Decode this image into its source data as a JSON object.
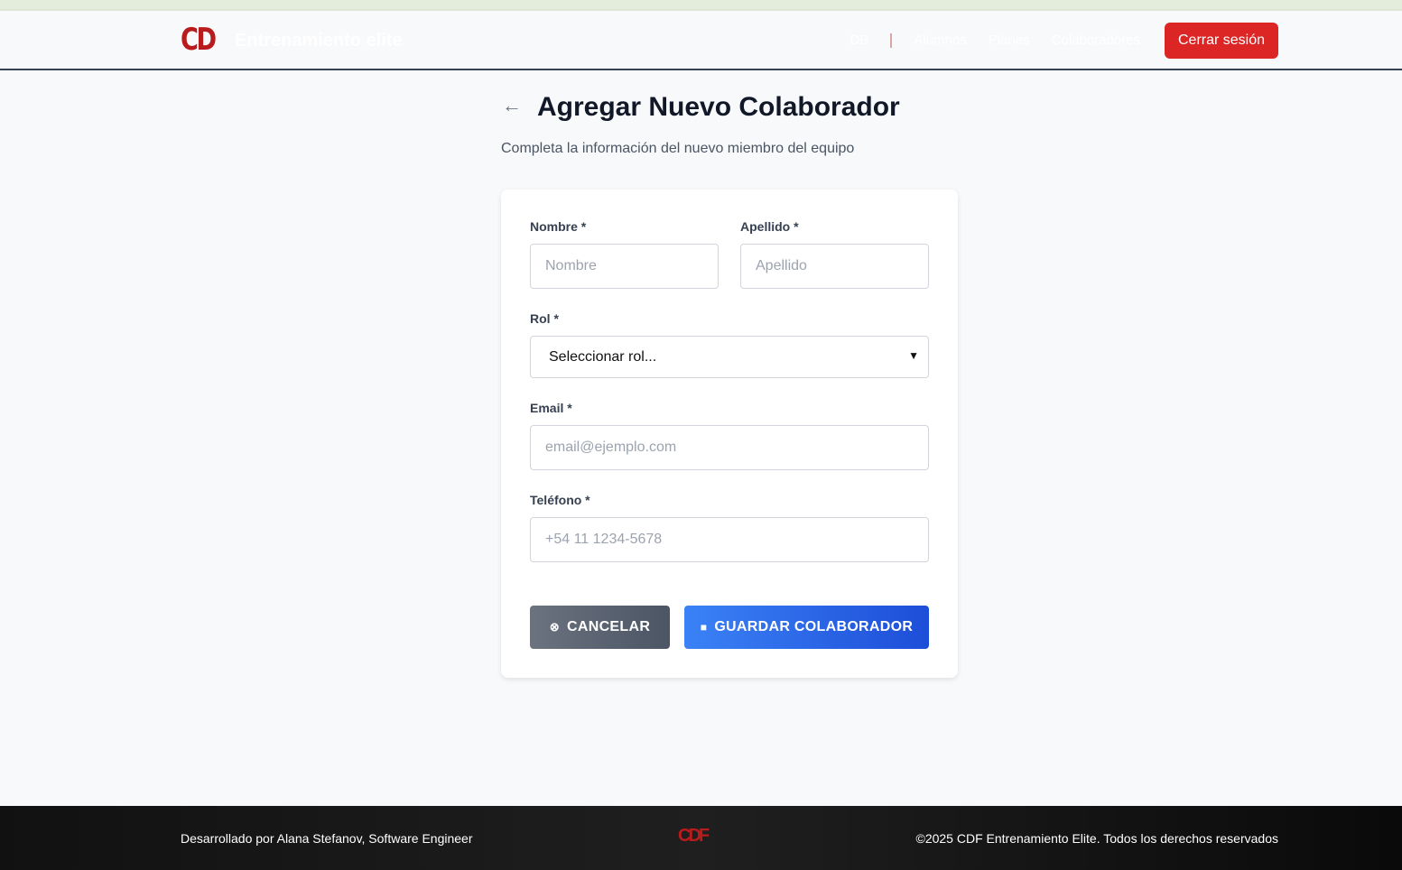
{
  "header": {
    "logo": "CD",
    "brand": "Entrenamiento elite",
    "nav": [
      "DB",
      "Alumnos",
      "Planes",
      "Colaboradores"
    ],
    "logout": "Cerrar sesión"
  },
  "page": {
    "title": "Agregar Nuevo Colaborador",
    "subtitle": "Completa la información del nuevo miembro del equipo"
  },
  "form": {
    "nombre": {
      "label": "Nombre *",
      "placeholder": "Nombre"
    },
    "apellido": {
      "label": "Apellido *",
      "placeholder": "Apellido"
    },
    "rol": {
      "label": "Rol *",
      "value": "Seleccionar rol..."
    },
    "email": {
      "label": "Email *",
      "placeholder": "email@ejemplo.com"
    },
    "telefono": {
      "label": "Teléfono *",
      "placeholder": "+54 11 1234-5678"
    },
    "cancel": "CANCELAR",
    "save": "GUARDAR COLABORADOR"
  },
  "footer": {
    "left": "Desarrollado por Alana Stefanov, Software Engineer",
    "logo": "CDF",
    "right": "©2025 CDF Entrenamiento Elite. Todos los derechos reservados"
  }
}
